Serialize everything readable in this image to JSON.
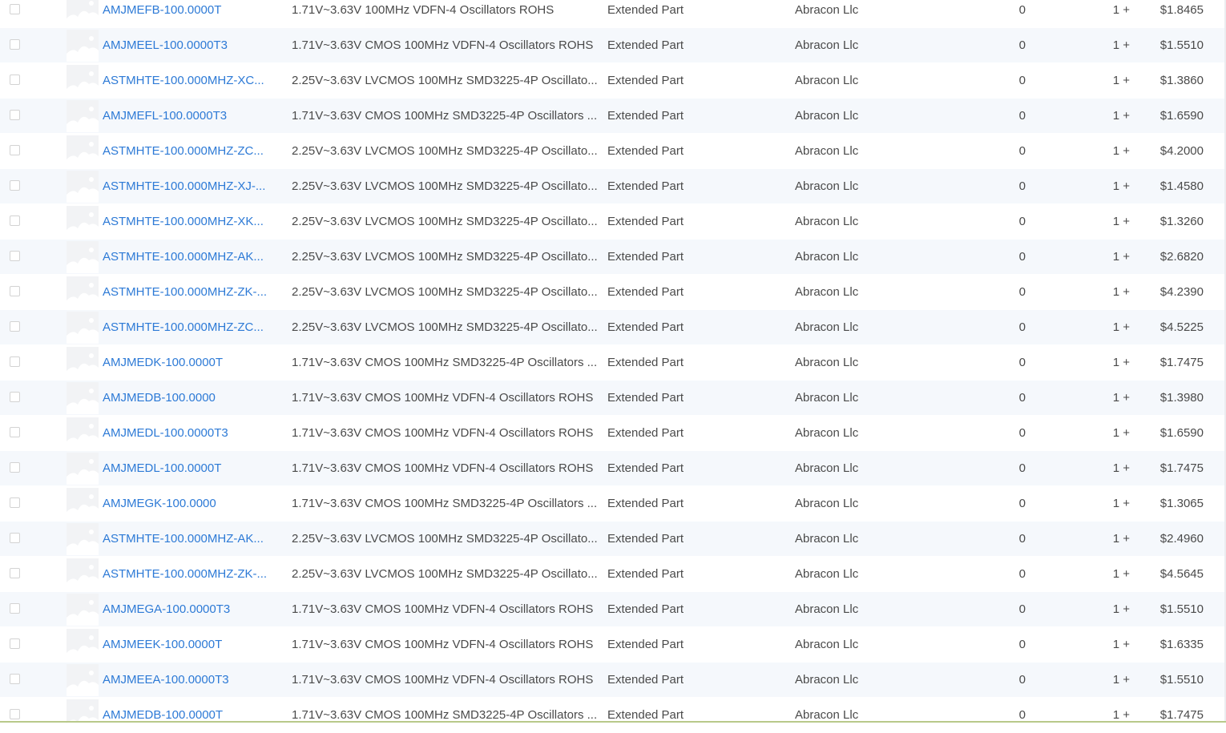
{
  "rows": [
    {
      "part": "AMJMEFB-100.0000T",
      "desc": "1.71V~3.63V 100MHz VDFN-4 Oscillators ROHS",
      "type": "Extended Part",
      "mfr": "Abracon Llc",
      "stock": "0",
      "qty": "1 +",
      "price": "$1.8465"
    },
    {
      "part": "AMJMEEL-100.0000T3",
      "desc": "1.71V~3.63V CMOS 100MHz VDFN-4 Oscillators ROHS",
      "type": "Extended Part",
      "mfr": "Abracon Llc",
      "stock": "0",
      "qty": "1 +",
      "price": "$1.5510"
    },
    {
      "part": "ASTMHTE-100.000MHZ-XC...",
      "desc": "2.25V~3.63V LVCMOS 100MHz SMD3225-4P Oscillato...",
      "type": "Extended Part",
      "mfr": "Abracon Llc",
      "stock": "0",
      "qty": "1 +",
      "price": "$1.3860"
    },
    {
      "part": "AMJMEFL-100.0000T3",
      "desc": "1.71V~3.63V CMOS 100MHz SMD3225-4P Oscillators ...",
      "type": "Extended Part",
      "mfr": "Abracon Llc",
      "stock": "0",
      "qty": "1 +",
      "price": "$1.6590"
    },
    {
      "part": "ASTMHTE-100.000MHZ-ZC...",
      "desc": "2.25V~3.63V LVCMOS 100MHz SMD3225-4P Oscillato...",
      "type": "Extended Part",
      "mfr": "Abracon Llc",
      "stock": "0",
      "qty": "1 +",
      "price": "$4.2000"
    },
    {
      "part": "ASTMHTE-100.000MHZ-XJ-...",
      "desc": "2.25V~3.63V LVCMOS 100MHz SMD3225-4P Oscillato...",
      "type": "Extended Part",
      "mfr": "Abracon Llc",
      "stock": "0",
      "qty": "1 +",
      "price": "$1.4580"
    },
    {
      "part": "ASTMHTE-100.000MHZ-XK...",
      "desc": "2.25V~3.63V LVCMOS 100MHz SMD3225-4P Oscillato...",
      "type": "Extended Part",
      "mfr": "Abracon Llc",
      "stock": "0",
      "qty": "1 +",
      "price": "$1.3260"
    },
    {
      "part": "ASTMHTE-100.000MHZ-AK...",
      "desc": "2.25V~3.63V LVCMOS 100MHz SMD3225-4P Oscillato...",
      "type": "Extended Part",
      "mfr": "Abracon Llc",
      "stock": "0",
      "qty": "1 +",
      "price": "$2.6820"
    },
    {
      "part": "ASTMHTE-100.000MHZ-ZK-...",
      "desc": "2.25V~3.63V LVCMOS 100MHz SMD3225-4P Oscillato...",
      "type": "Extended Part",
      "mfr": "Abracon Llc",
      "stock": "0",
      "qty": "1 +",
      "price": "$4.2390"
    },
    {
      "part": "ASTMHTE-100.000MHZ-ZC...",
      "desc": "2.25V~3.63V LVCMOS 100MHz SMD3225-4P Oscillato...",
      "type": "Extended Part",
      "mfr": "Abracon Llc",
      "stock": "0",
      "qty": "1 +",
      "price": "$4.5225"
    },
    {
      "part": "AMJMEDK-100.0000T",
      "desc": "1.71V~3.63V CMOS 100MHz SMD3225-4P Oscillators ...",
      "type": "Extended Part",
      "mfr": "Abracon Llc",
      "stock": "0",
      "qty": "1 +",
      "price": "$1.7475"
    },
    {
      "part": "AMJMEDB-100.0000",
      "desc": "1.71V~3.63V CMOS 100MHz VDFN-4 Oscillators ROHS",
      "type": "Extended Part",
      "mfr": "Abracon Llc",
      "stock": "0",
      "qty": "1 +",
      "price": "$1.3980"
    },
    {
      "part": "AMJMEDL-100.0000T3",
      "desc": "1.71V~3.63V CMOS 100MHz VDFN-4 Oscillators ROHS",
      "type": "Extended Part",
      "mfr": "Abracon Llc",
      "stock": "0",
      "qty": "1 +",
      "price": "$1.6590"
    },
    {
      "part": "AMJMEDL-100.0000T",
      "desc": "1.71V~3.63V CMOS 100MHz VDFN-4 Oscillators ROHS",
      "type": "Extended Part",
      "mfr": "Abracon Llc",
      "stock": "0",
      "qty": "1 +",
      "price": "$1.7475"
    },
    {
      "part": "AMJMEGK-100.0000",
      "desc": "1.71V~3.63V CMOS 100MHz SMD3225-4P Oscillators ...",
      "type": "Extended Part",
      "mfr": "Abracon Llc",
      "stock": "0",
      "qty": "1 +",
      "price": "$1.3065"
    },
    {
      "part": "ASTMHTE-100.000MHZ-AK...",
      "desc": "2.25V~3.63V LVCMOS 100MHz SMD3225-4P Oscillato...",
      "type": "Extended Part",
      "mfr": "Abracon Llc",
      "stock": "0",
      "qty": "1 +",
      "price": "$2.4960"
    },
    {
      "part": "ASTMHTE-100.000MHZ-ZK-...",
      "desc": "2.25V~3.63V LVCMOS 100MHz SMD3225-4P Oscillato...",
      "type": "Extended Part",
      "mfr": "Abracon Llc",
      "stock": "0",
      "qty": "1 +",
      "price": "$4.5645"
    },
    {
      "part": "AMJMEGA-100.0000T3",
      "desc": "1.71V~3.63V CMOS 100MHz VDFN-4 Oscillators ROHS",
      "type": "Extended Part",
      "mfr": "Abracon Llc",
      "stock": "0",
      "qty": "1 +",
      "price": "$1.5510"
    },
    {
      "part": "AMJMEEK-100.0000T",
      "desc": "1.71V~3.63V CMOS 100MHz VDFN-4 Oscillators ROHS",
      "type": "Extended Part",
      "mfr": "Abracon Llc",
      "stock": "0",
      "qty": "1 +",
      "price": "$1.6335"
    },
    {
      "part": "AMJMEEA-100.0000T3",
      "desc": "1.71V~3.63V CMOS 100MHz VDFN-4 Oscillators ROHS",
      "type": "Extended Part",
      "mfr": "Abracon Llc",
      "stock": "0",
      "qty": "1 +",
      "price": "$1.5510"
    },
    {
      "part": "AMJMEDB-100.0000T",
      "desc": "1.71V~3.63V CMOS 100MHz SMD3225-4P Oscillators ...",
      "type": "Extended Part",
      "mfr": "Abracon Llc",
      "stock": "0",
      "qty": "1 +",
      "price": "$1.7475"
    }
  ],
  "colors": {
    "link": "#2d7ad6",
    "text": "#4a4a4a",
    "row_alt": "#f5f8fc"
  },
  "icons": {
    "checkbox": "checkbox-icon",
    "thumbnail": "image-placeholder-icon"
  }
}
